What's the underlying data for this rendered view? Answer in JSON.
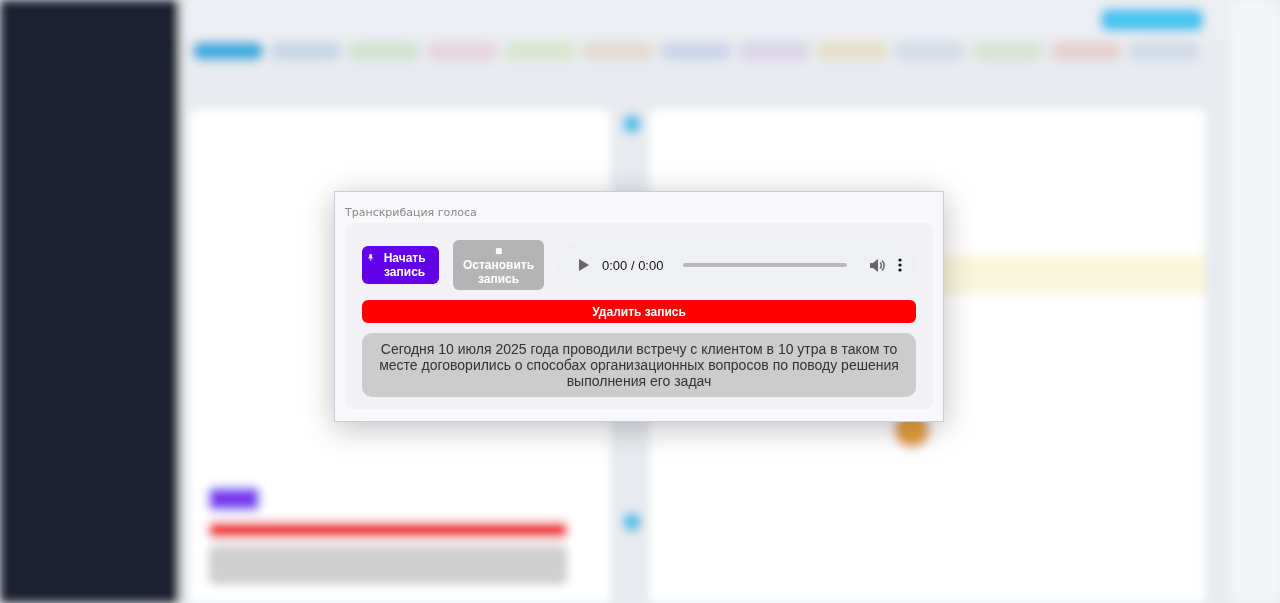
{
  "dialog": {
    "title": "Транскрибация голоса",
    "buttons": [
      {
        "kind": "start",
        "label": "Начать запись",
        "disabled": false
      },
      {
        "kind": "stop",
        "icon": "■",
        "label": "Остановить запись",
        "disabled": true
      }
    ],
    "player": {
      "time": "0:00 / 0:00"
    },
    "delete_button": "Удалить запись",
    "transcript": "Сегодня 10 июля 2025 года проводили встречу с клиентом в 10 утра в таком то месте договорились о способах организационных вопросов по поводу решения выполнения его задач"
  }
}
